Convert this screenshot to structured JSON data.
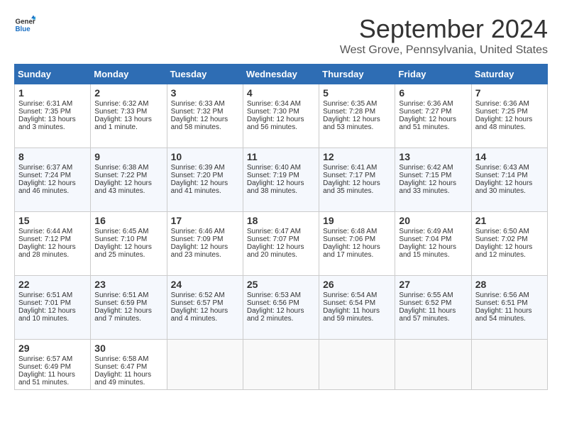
{
  "header": {
    "logo_general": "General",
    "logo_blue": "Blue",
    "month": "September 2024",
    "location": "West Grove, Pennsylvania, United States"
  },
  "days_of_week": [
    "Sunday",
    "Monday",
    "Tuesday",
    "Wednesday",
    "Thursday",
    "Friday",
    "Saturday"
  ],
  "weeks": [
    [
      {
        "day": "1",
        "info": "Sunrise: 6:31 AM\nSunset: 7:35 PM\nDaylight: 13 hours\nand 3 minutes."
      },
      {
        "day": "2",
        "info": "Sunrise: 6:32 AM\nSunset: 7:33 PM\nDaylight: 13 hours\nand 1 minute."
      },
      {
        "day": "3",
        "info": "Sunrise: 6:33 AM\nSunset: 7:32 PM\nDaylight: 12 hours\nand 58 minutes."
      },
      {
        "day": "4",
        "info": "Sunrise: 6:34 AM\nSunset: 7:30 PM\nDaylight: 12 hours\nand 56 minutes."
      },
      {
        "day": "5",
        "info": "Sunrise: 6:35 AM\nSunset: 7:28 PM\nDaylight: 12 hours\nand 53 minutes."
      },
      {
        "day": "6",
        "info": "Sunrise: 6:36 AM\nSunset: 7:27 PM\nDaylight: 12 hours\nand 51 minutes."
      },
      {
        "day": "7",
        "info": "Sunrise: 6:36 AM\nSunset: 7:25 PM\nDaylight: 12 hours\nand 48 minutes."
      }
    ],
    [
      {
        "day": "8",
        "info": "Sunrise: 6:37 AM\nSunset: 7:24 PM\nDaylight: 12 hours\nand 46 minutes."
      },
      {
        "day": "9",
        "info": "Sunrise: 6:38 AM\nSunset: 7:22 PM\nDaylight: 12 hours\nand 43 minutes."
      },
      {
        "day": "10",
        "info": "Sunrise: 6:39 AM\nSunset: 7:20 PM\nDaylight: 12 hours\nand 41 minutes."
      },
      {
        "day": "11",
        "info": "Sunrise: 6:40 AM\nSunset: 7:19 PM\nDaylight: 12 hours\nand 38 minutes."
      },
      {
        "day": "12",
        "info": "Sunrise: 6:41 AM\nSunset: 7:17 PM\nDaylight: 12 hours\nand 35 minutes."
      },
      {
        "day": "13",
        "info": "Sunrise: 6:42 AM\nSunset: 7:15 PM\nDaylight: 12 hours\nand 33 minutes."
      },
      {
        "day": "14",
        "info": "Sunrise: 6:43 AM\nSunset: 7:14 PM\nDaylight: 12 hours\nand 30 minutes."
      }
    ],
    [
      {
        "day": "15",
        "info": "Sunrise: 6:44 AM\nSunset: 7:12 PM\nDaylight: 12 hours\nand 28 minutes."
      },
      {
        "day": "16",
        "info": "Sunrise: 6:45 AM\nSunset: 7:10 PM\nDaylight: 12 hours\nand 25 minutes."
      },
      {
        "day": "17",
        "info": "Sunrise: 6:46 AM\nSunset: 7:09 PM\nDaylight: 12 hours\nand 23 minutes."
      },
      {
        "day": "18",
        "info": "Sunrise: 6:47 AM\nSunset: 7:07 PM\nDaylight: 12 hours\nand 20 minutes."
      },
      {
        "day": "19",
        "info": "Sunrise: 6:48 AM\nSunset: 7:06 PM\nDaylight: 12 hours\nand 17 minutes."
      },
      {
        "day": "20",
        "info": "Sunrise: 6:49 AM\nSunset: 7:04 PM\nDaylight: 12 hours\nand 15 minutes."
      },
      {
        "day": "21",
        "info": "Sunrise: 6:50 AM\nSunset: 7:02 PM\nDaylight: 12 hours\nand 12 minutes."
      }
    ],
    [
      {
        "day": "22",
        "info": "Sunrise: 6:51 AM\nSunset: 7:01 PM\nDaylight: 12 hours\nand 10 minutes."
      },
      {
        "day": "23",
        "info": "Sunrise: 6:51 AM\nSunset: 6:59 PM\nDaylight: 12 hours\nand 7 minutes."
      },
      {
        "day": "24",
        "info": "Sunrise: 6:52 AM\nSunset: 6:57 PM\nDaylight: 12 hours\nand 4 minutes."
      },
      {
        "day": "25",
        "info": "Sunrise: 6:53 AM\nSunset: 6:56 PM\nDaylight: 12 hours\nand 2 minutes."
      },
      {
        "day": "26",
        "info": "Sunrise: 6:54 AM\nSunset: 6:54 PM\nDaylight: 11 hours\nand 59 minutes."
      },
      {
        "day": "27",
        "info": "Sunrise: 6:55 AM\nSunset: 6:52 PM\nDaylight: 11 hours\nand 57 minutes."
      },
      {
        "day": "28",
        "info": "Sunrise: 6:56 AM\nSunset: 6:51 PM\nDaylight: 11 hours\nand 54 minutes."
      }
    ],
    [
      {
        "day": "29",
        "info": "Sunrise: 6:57 AM\nSunset: 6:49 PM\nDaylight: 11 hours\nand 51 minutes."
      },
      {
        "day": "30",
        "info": "Sunrise: 6:58 AM\nSunset: 6:47 PM\nDaylight: 11 hours\nand 49 minutes."
      },
      {
        "day": "",
        "info": ""
      },
      {
        "day": "",
        "info": ""
      },
      {
        "day": "",
        "info": ""
      },
      {
        "day": "",
        "info": ""
      },
      {
        "day": "",
        "info": ""
      }
    ]
  ]
}
